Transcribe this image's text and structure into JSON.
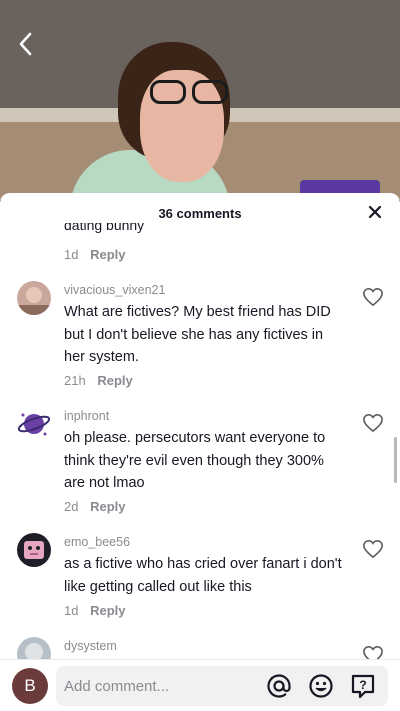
{
  "video": {
    "back_icon": "chevron-left-icon"
  },
  "header": {
    "title": "36 comments",
    "close_label": "✕"
  },
  "partial_comment": {
    "text": "dating bunny",
    "time": "1d",
    "reply_label": "Reply"
  },
  "comments": [
    {
      "username": "vivacious_vixen21",
      "text": "What are fictives? My best friend has DID but I don't believe she has any fictives in her system.",
      "time": "21h",
      "reply_label": "Reply",
      "avatar_color": "#c9a79c"
    },
    {
      "username": "inphront",
      "text": "oh please. persecutors want everyone to think they're evil even though they 300% are not lmao",
      "time": "2d",
      "reply_label": "Reply",
      "avatar_color": "#6a3fa6"
    },
    {
      "username": "emo_bee56",
      "text": "as a fictive who has cried over fanart i don't like getting called out like this",
      "time": "1d",
      "reply_label": "Reply",
      "avatar_color": "#e6a5c1"
    },
    {
      "username": "dysystem",
      "avatar_color": "#b7c0c8"
    }
  ],
  "bottom_bar": {
    "avatar_letter": "B",
    "input_placeholder": "Add comment...",
    "icons": [
      "at-icon",
      "emoji-icon",
      "question-sticker-icon"
    ]
  },
  "colors": {
    "text": "#161823",
    "muted": "#8a8b91",
    "sheet_bg": "#ffffff"
  }
}
